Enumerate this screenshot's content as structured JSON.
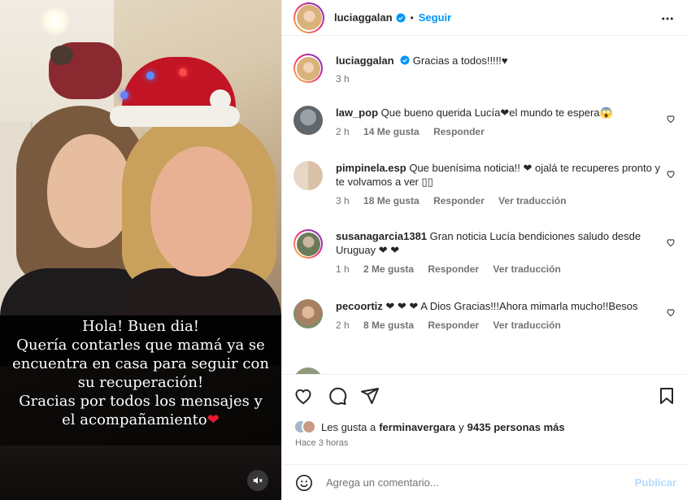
{
  "post": {
    "username": "luciaggalan",
    "follow_label": "Seguir",
    "separator": "•"
  },
  "media": {
    "caption_lines": [
      "Hola! Buen dia!",
      "Quería contarles que mamá ya se",
      "encuentra en casa para seguir con",
      "su recuperación!",
      "Gracias por todos los mensajes y",
      "el acompañamiento"
    ],
    "caption_heart": "❤"
  },
  "caption": {
    "username": "luciaggalan",
    "text": "Gracias a todos!!!!!♥",
    "time": "3 h"
  },
  "comments": [
    {
      "username": "law_pop",
      "text": "Que bueno querida Lucía❤el mundo te espera😱",
      "time": "2 h",
      "likes": "14 Me gusta",
      "reply": "Responder",
      "translate": ""
    },
    {
      "username": "pimpinela.esp",
      "text": "Que buenísima noticia!! ❤ ojalá te recuperes pronto y te volvamos a ver ▯▯",
      "time": "3 h",
      "likes": "18 Me gusta",
      "reply": "Responder",
      "translate": "Ver traducción"
    },
    {
      "username": "susanagarcia1381",
      "text": "Gran noticia Lucía bendiciones saludo desde Uruguay ❤ ❤",
      "time": "1 h",
      "likes": "2 Me gusta",
      "reply": "Responder",
      "translate": "Ver traducción"
    },
    {
      "username": "pecoortiz",
      "text": "❤ ❤ ❤ A Dios Gracias!!!Ahora mimarla mucho!!Besos",
      "time": "2 h",
      "likes": "8 Me gusta",
      "reply": "Responder",
      "translate": "Ver traducción"
    }
  ],
  "likes": {
    "prefix": "Les gusta a",
    "user": "ferminavergara",
    "middle": "y",
    "count": "9435 personas más"
  },
  "posted_time": "Hace 3 horas",
  "add_comment": {
    "placeholder": "Agrega un comentario...",
    "publish_label": "Publicar"
  },
  "colors": {
    "accent": "#0095f6",
    "heart": "#e8182e",
    "muted": "#737373"
  }
}
